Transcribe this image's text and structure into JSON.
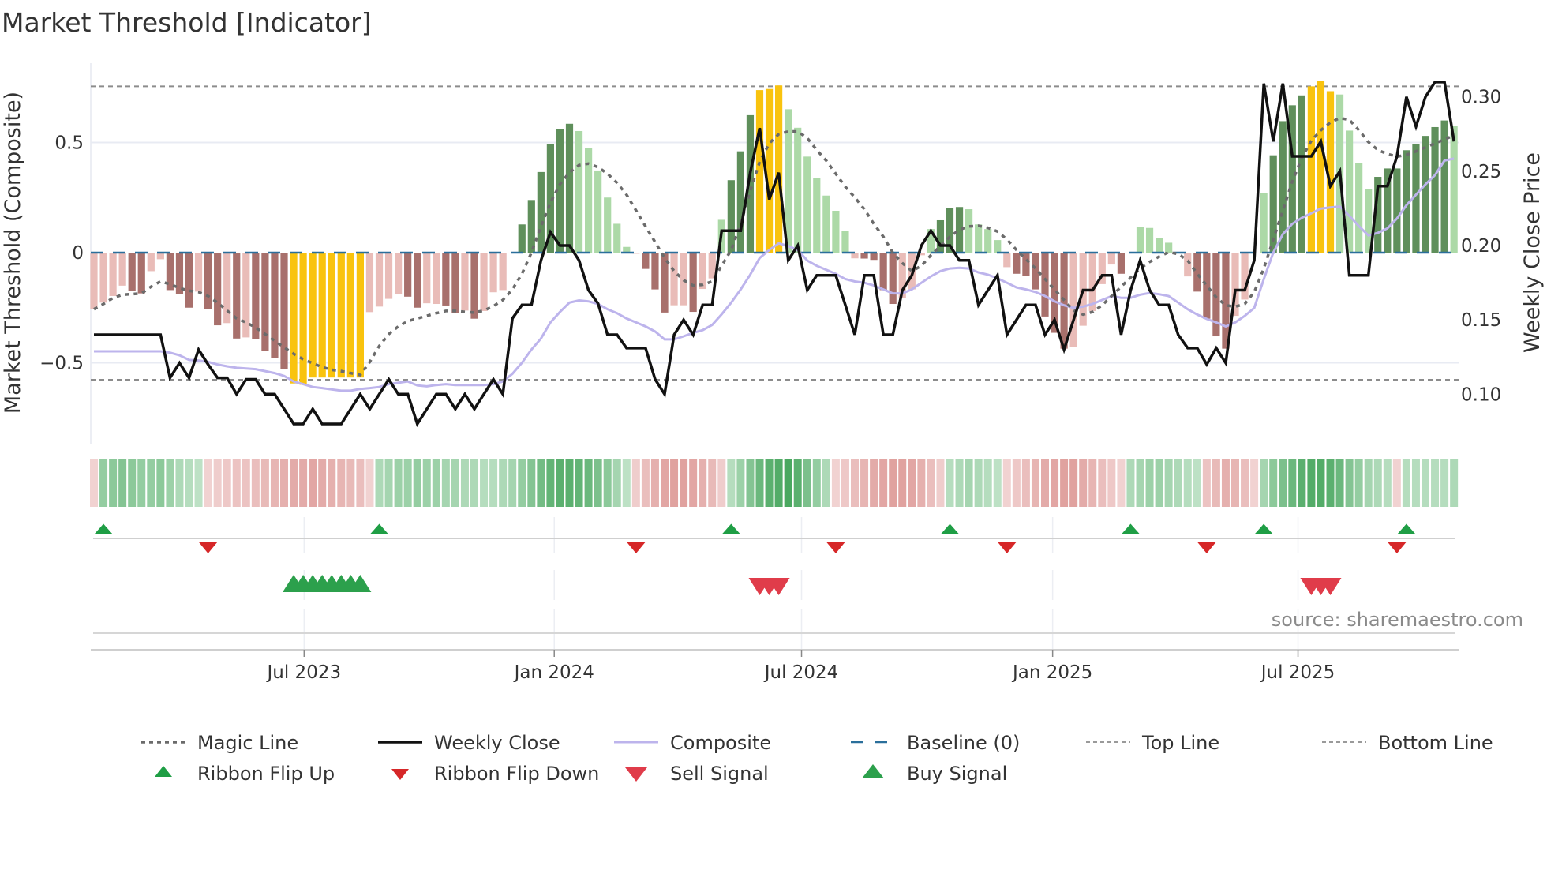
{
  "title": "Market Threshold [Indicator]",
  "source": "source: sharemaestro.com",
  "colors": {
    "bar_light_red": "#e9bcb8",
    "bar_dark_red": "#a8706c",
    "bar_yellow": "#f9c30e",
    "bar_dark_green": "#5f8f5b",
    "bar_light_green": "#acd9a7",
    "magic_line": "#6b6b6b",
    "weekly_close": "#111111",
    "composite": "#bdb4ec",
    "baseline": "#2a6f9b",
    "threshold_lines": "#8c8c8c",
    "ribbon_up": "#1f9e45",
    "ribbon_down": "#d62728",
    "buy_signal": "#2ca04c",
    "sell_signal": "#e03c4a"
  },
  "chart_data": {
    "type": "bar",
    "title": "Market Threshold [Indicator]",
    "ylabel_left": "Market Threshold (Composite)",
    "ylabel_right": "Weekly Close Price",
    "ylim_left": [
      -0.72,
      0.86
    ],
    "ylim_right": [
      0.065,
      0.34
    ],
    "left_ticks": [
      {
        "value": 0.5,
        "label": "0.5"
      },
      {
        "value": 0,
        "label": "0"
      },
      {
        "value": -0.5,
        "label": "−0.5"
      }
    ],
    "right_ticks": [
      {
        "value": 0.3,
        "label": "0.30"
      },
      {
        "value": 0.25,
        "label": "0.25"
      },
      {
        "value": 0.2,
        "label": "0.20"
      },
      {
        "value": 0.15,
        "label": "0.15"
      },
      {
        "value": 0.1,
        "label": "0.10"
      }
    ],
    "x_unit": "week index (0 = first week shown, ~late Jan 2023)",
    "x_ticks": [
      {
        "label": "Jul 2023",
        "week": 22.1
      },
      {
        "label": "Jan 2024",
        "week": 48.4
      },
      {
        "label": "Jul 2024",
        "week": 74.4
      },
      {
        "label": "Jan 2025",
        "week": 100.8
      },
      {
        "label": "Jul 2025",
        "week": 126.6
      }
    ],
    "top_line": 0.755,
    "bottom_line": -0.577,
    "baseline": 0,
    "bar_values": [
      -0.257,
      -0.227,
      -0.197,
      -0.15,
      -0.173,
      -0.185,
      -0.084,
      -0.03,
      -0.17,
      -0.189,
      -0.25,
      -0.177,
      -0.257,
      -0.33,
      -0.32,
      -0.39,
      -0.385,
      -0.394,
      -0.446,
      -0.48,
      -0.53,
      -0.594,
      -0.6,
      -0.567,
      -0.567,
      -0.567,
      -0.567,
      -0.567,
      -0.567,
      -0.27,
      -0.245,
      -0.21,
      -0.19,
      -0.2,
      -0.25,
      -0.23,
      -0.233,
      -0.24,
      -0.275,
      -0.263,
      -0.3,
      -0.265,
      -0.18,
      -0.17,
      0,
      0.128,
      0.239,
      0.366,
      0.493,
      0.56,
      0.585,
      0.552,
      0.475,
      0.373,
      0.25,
      0.131,
      0.026,
      -0.005,
      -0.074,
      -0.167,
      -0.272,
      -0.239,
      -0.239,
      -0.269,
      -0.165,
      -0.117,
      0.149,
      0.329,
      0.46,
      0.624,
      0.738,
      0.743,
      0.759,
      0.651,
      0.567,
      0.436,
      0.337,
      0.259,
      0.19,
      0.1,
      -0.026,
      -0.027,
      -0.033,
      -0.17,
      -0.233,
      -0.205,
      -0.167,
      -0.012,
      0.107,
      0.147,
      0.203,
      0.207,
      0.197,
      0.128,
      0.107,
      0.057,
      -0.066,
      -0.096,
      -0.105,
      -0.167,
      -0.29,
      -0.364,
      -0.436,
      -0.43,
      -0.332,
      -0.265,
      -0.143,
      -0.054,
      -0.096,
      0,
      0.117,
      0.112,
      0.068,
      0.045,
      0,
      -0.108,
      -0.177,
      -0.3,
      -0.38,
      -0.436,
      -0.287,
      -0.213,
      0,
      0.269,
      0.442,
      0.597,
      0.669,
      0.714,
      0.755,
      0.779,
      0.733,
      0.718,
      0.554,
      0.406,
      0.287,
      0.344,
      0.382,
      0.382,
      0.465,
      0.493,
      0.53,
      0.57,
      0.6,
      0.576
    ],
    "bar_state": [
      "lr",
      "lr",
      "lr",
      "lr",
      "dr",
      "dr",
      "lr",
      "lr",
      "dr",
      "dr",
      "dr",
      "lr",
      "dr",
      "dr",
      "lr",
      "dr",
      "lr",
      "dr",
      "dr",
      "dr",
      "dr",
      "y",
      "y",
      "y",
      "y",
      "y",
      "y",
      "y",
      "y",
      "lr",
      "lr",
      "lr",
      "lr",
      "dr",
      "dr",
      "lr",
      "lr",
      "dr",
      "dr",
      "lr",
      "dr",
      "lr",
      "lr",
      "lr",
      "lr",
      "dg",
      "dg",
      "dg",
      "dg",
      "dg",
      "dg",
      "lg",
      "lg",
      "lg",
      "lg",
      "lg",
      "lg",
      "lr",
      "dr",
      "dr",
      "dr",
      "lr",
      "lr",
      "dr",
      "lr",
      "lr",
      "lg",
      "dg",
      "dg",
      "dg",
      "y",
      "y",
      "y",
      "lg",
      "lg",
      "lg",
      "lg",
      "lg",
      "lg",
      "lg",
      "lr",
      "dr",
      "dr",
      "dr",
      "dr",
      "lr",
      "lr",
      "lr",
      "lg",
      "dg",
      "dg",
      "dg",
      "lg",
      "lg",
      "lg",
      "lg",
      "lr",
      "dr",
      "dr",
      "dr",
      "dr",
      "dr",
      "dr",
      "lr",
      "lr",
      "lr",
      "lr",
      "lr",
      "dr",
      "lg",
      "lg",
      "lg",
      "lg",
      "lg",
      "lr",
      "lr",
      "dr",
      "dr",
      "dr",
      "dr",
      "lr",
      "lr",
      "lg",
      "lg",
      "dg",
      "dg",
      "dg",
      "dg",
      "y",
      "y",
      "y",
      "lg",
      "lg",
      "lg",
      "lg",
      "dg",
      "dg",
      "dg",
      "dg",
      "dg",
      "dg",
      "dg",
      "dg",
      "lg"
    ],
    "series": [
      {
        "name": "Magic Line",
        "axis": "left",
        "values": [
          -0.257,
          -0.233,
          -0.206,
          -0.191,
          -0.188,
          -0.185,
          -0.155,
          -0.131,
          -0.143,
          -0.161,
          -0.173,
          -0.179,
          -0.197,
          -0.227,
          -0.263,
          -0.299,
          -0.317,
          -0.34,
          -0.37,
          -0.4,
          -0.43,
          -0.46,
          -0.484,
          -0.502,
          -0.52,
          -0.532,
          -0.538,
          -0.547,
          -0.556,
          -0.496,
          -0.424,
          -0.37,
          -0.335,
          -0.311,
          -0.299,
          -0.287,
          -0.275,
          -0.265,
          -0.265,
          -0.269,
          -0.272,
          -0.263,
          -0.243,
          -0.215,
          -0.167,
          -0.096,
          0,
          0.119,
          0.227,
          0.311,
          0.364,
          0.397,
          0.404,
          0.388,
          0.358,
          0.317,
          0.263,
          0.191,
          0.119,
          0.048,
          -0.024,
          -0.084,
          -0.125,
          -0.149,
          -0.146,
          -0.131,
          -0.06,
          0.012,
          0.131,
          0.281,
          0.412,
          0.496,
          0.538,
          0.55,
          0.55,
          0.52,
          0.466,
          0.418,
          0.358,
          0.299,
          0.251,
          0.197,
          0.131,
          0.072,
          0,
          -0.048,
          -0.084,
          -0.06,
          -0.012,
          0.03,
          0.072,
          0.104,
          0.119,
          0.122,
          0.113,
          0.096,
          0.06,
          0.012,
          -0.03,
          -0.072,
          -0.12,
          -0.167,
          -0.215,
          -0.263,
          -0.281,
          -0.269,
          -0.239,
          -0.197,
          -0.155,
          -0.113,
          -0.072,
          -0.042,
          -0.018,
          0.002,
          -0.006,
          -0.036,
          -0.096,
          -0.149,
          -0.203,
          -0.239,
          -0.245,
          -0.233,
          -0.179,
          -0.072,
          0.06,
          0.191,
          0.323,
          0.43,
          0.508,
          0.556,
          0.591,
          0.611,
          0.603,
          0.556,
          0.502,
          0.466,
          0.448,
          0.436,
          0.444,
          0.46,
          0.478,
          0.496,
          0.514,
          0.532
        ]
      },
      {
        "name": "Weekly Close",
        "axis": "right",
        "values": [
          0.14,
          0.14,
          0.14,
          0.14,
          0.14,
          0.14,
          0.14,
          0.14,
          0.111,
          0.121,
          0.111,
          0.13,
          0.12,
          0.111,
          0.111,
          0.1,
          0.11,
          0.11,
          0.1,
          0.1,
          0.09,
          0.08,
          0.08,
          0.09,
          0.08,
          0.08,
          0.08,
          0.09,
          0.1,
          0.09,
          0.1,
          0.11,
          0.1,
          0.1,
          0.08,
          0.09,
          0.1,
          0.1,
          0.09,
          0.1,
          0.09,
          0.1,
          0.11,
          0.1,
          0.151,
          0.16,
          0.16,
          0.19,
          0.209,
          0.2,
          0.2,
          0.19,
          0.17,
          0.161,
          0.14,
          0.14,
          0.131,
          0.131,
          0.131,
          0.11,
          0.1,
          0.14,
          0.15,
          0.14,
          0.16,
          0.16,
          0.21,
          0.21,
          0.21,
          0.249,
          0.279,
          0.231,
          0.249,
          0.19,
          0.2,
          0.17,
          0.18,
          0.18,
          0.18,
          0.16,
          0.14,
          0.18,
          0.18,
          0.14,
          0.14,
          0.17,
          0.18,
          0.2,
          0.21,
          0.2,
          0.2,
          0.19,
          0.19,
          0.16,
          0.17,
          0.18,
          0.14,
          0.15,
          0.16,
          0.16,
          0.14,
          0.15,
          0.13,
          0.15,
          0.17,
          0.17,
          0.18,
          0.18,
          0.14,
          0.17,
          0.19,
          0.17,
          0.16,
          0.16,
          0.14,
          0.131,
          0.131,
          0.12,
          0.131,
          0.121,
          0.17,
          0.17,
          0.19,
          0.309,
          0.27,
          0.309,
          0.26,
          0.26,
          0.26,
          0.27,
          0.24,
          0.25,
          0.18,
          0.18,
          0.18,
          0.24,
          0.24,
          0.26,
          0.3,
          0.28,
          0.3,
          0.31,
          0.31,
          0.27
        ]
      },
      {
        "name": "Composite",
        "axis": "left",
        "values": [
          -0.448,
          -0.448,
          -0.448,
          -0.448,
          -0.448,
          -0.448,
          -0.448,
          -0.448,
          -0.454,
          -0.466,
          -0.487,
          -0.49,
          -0.496,
          -0.508,
          -0.516,
          -0.523,
          -0.526,
          -0.529,
          -0.538,
          -0.547,
          -0.56,
          -0.585,
          -0.597,
          -0.61,
          -0.615,
          -0.621,
          -0.627,
          -0.627,
          -0.619,
          -0.615,
          -0.61,
          -0.597,
          -0.591,
          -0.585,
          -0.603,
          -0.607,
          -0.601,
          -0.597,
          -0.601,
          -0.601,
          -0.601,
          -0.601,
          -0.597,
          -0.585,
          -0.55,
          -0.5,
          -0.44,
          -0.39,
          -0.317,
          -0.269,
          -0.227,
          -0.217,
          -0.221,
          -0.233,
          -0.257,
          -0.275,
          -0.299,
          -0.317,
          -0.335,
          -0.358,
          -0.394,
          -0.394,
          -0.38,
          -0.364,
          -0.352,
          -0.328,
          -0.28,
          -0.227,
          -0.167,
          -0.1,
          -0.024,
          0.012,
          0.042,
          0.03,
          0.012,
          -0.036,
          -0.06,
          -0.078,
          -0.096,
          -0.12,
          -0.131,
          -0.137,
          -0.149,
          -0.167,
          -0.185,
          -0.185,
          -0.167,
          -0.137,
          -0.108,
          -0.084,
          -0.072,
          -0.069,
          -0.072,
          -0.09,
          -0.1,
          -0.117,
          -0.137,
          -0.158,
          -0.167,
          -0.179,
          -0.197,
          -0.221,
          -0.239,
          -0.251,
          -0.245,
          -0.233,
          -0.215,
          -0.197,
          -0.205,
          -0.205,
          -0.191,
          -0.183,
          -0.189,
          -0.197,
          -0.227,
          -0.257,
          -0.281,
          -0.301,
          -0.317,
          -0.335,
          -0.317,
          -0.287,
          -0.251,
          -0.12,
          0,
          0.084,
          0.131,
          0.158,
          0.179,
          0.2,
          0.205,
          0.209,
          0.167,
          0.12,
          0.078,
          0.09,
          0.11,
          0.155,
          0.215,
          0.263,
          0.31,
          0.352,
          0.418,
          0.427
        ]
      }
    ],
    "ribbon_heat": [
      -0.15,
      0.45,
      0.5,
      0.55,
      0.5,
      0.45,
      0.45,
      0.5,
      0.4,
      0.3,
      0.25,
      0.2,
      -0.15,
      -0.2,
      -0.25,
      -0.3,
      -0.3,
      -0.35,
      -0.4,
      -0.45,
      -0.5,
      -0.55,
      -0.55,
      -0.6,
      -0.55,
      -0.5,
      -0.45,
      -0.4,
      -0.35,
      -0.15,
      0.3,
      0.35,
      0.4,
      0.4,
      0.45,
      0.4,
      0.4,
      0.35,
      0.35,
      0.3,
      0.3,
      0.25,
      0.25,
      0.3,
      0.35,
      0.45,
      0.55,
      0.65,
      0.75,
      0.8,
      0.8,
      0.75,
      0.7,
      0.6,
      0.5,
      0.35,
      0.2,
      -0.2,
      -0.35,
      -0.5,
      -0.6,
      -0.65,
      -0.65,
      -0.6,
      -0.5,
      -0.4,
      -0.2,
      0.25,
      0.4,
      0.55,
      0.7,
      0.8,
      0.85,
      0.9,
      0.8,
      0.6,
      0.45,
      0.3,
      -0.15,
      -0.25,
      -0.35,
      -0.45,
      -0.55,
      -0.6,
      -0.65,
      -0.65,
      -0.6,
      -0.5,
      -0.35,
      -0.2,
      0.25,
      0.3,
      0.35,
      0.3,
      0.25,
      0.2,
      -0.15,
      -0.25,
      -0.35,
      -0.45,
      -0.55,
      -0.6,
      -0.65,
      -0.65,
      -0.55,
      -0.45,
      -0.35,
      -0.25,
      -0.15,
      0.3,
      0.35,
      0.4,
      0.4,
      0.35,
      0.3,
      0.25,
      0.2,
      -0.3,
      -0.4,
      -0.5,
      -0.45,
      -0.35,
      -0.15,
      0.35,
      0.5,
      0.6,
      0.7,
      0.8,
      0.85,
      0.85,
      0.8,
      0.7,
      0.55,
      0.45,
      0.35,
      0.3,
      0.25,
      -0.15,
      0.25,
      0.25,
      0.25,
      0.25,
      0.25,
      0.3
    ],
    "ribbon_flip_up_weeks": [
      2,
      31,
      68,
      91,
      110,
      124,
      139
    ],
    "ribbon_flip_down_weeks": [
      13,
      58,
      79,
      97,
      118,
      138
    ],
    "buy_signal_weeks": [
      22,
      23,
      24,
      25,
      26,
      27,
      28,
      29
    ],
    "sell_signal_weeks": [
      71,
      72,
      73,
      129,
      130,
      131
    ],
    "legend": {
      "placement": "bottom",
      "items": [
        {
          "label": "Magic Line",
          "kind": "dotted-line"
        },
        {
          "label": "Weekly Close",
          "kind": "solid-line"
        },
        {
          "label": "Composite",
          "kind": "composite-line"
        },
        {
          "label": "Baseline (0)",
          "kind": "baseline-dash"
        },
        {
          "label": "Top Line",
          "kind": "thin-dash"
        },
        {
          "label": "Bottom Line",
          "kind": "thin-dash"
        },
        {
          "label": "Ribbon Flip Up",
          "kind": "ribbon-up"
        },
        {
          "label": "Ribbon Flip Down",
          "kind": "ribbon-down"
        },
        {
          "label": "Sell Signal",
          "kind": "sell"
        },
        {
          "label": "Buy Signal",
          "kind": "buy"
        }
      ]
    }
  }
}
